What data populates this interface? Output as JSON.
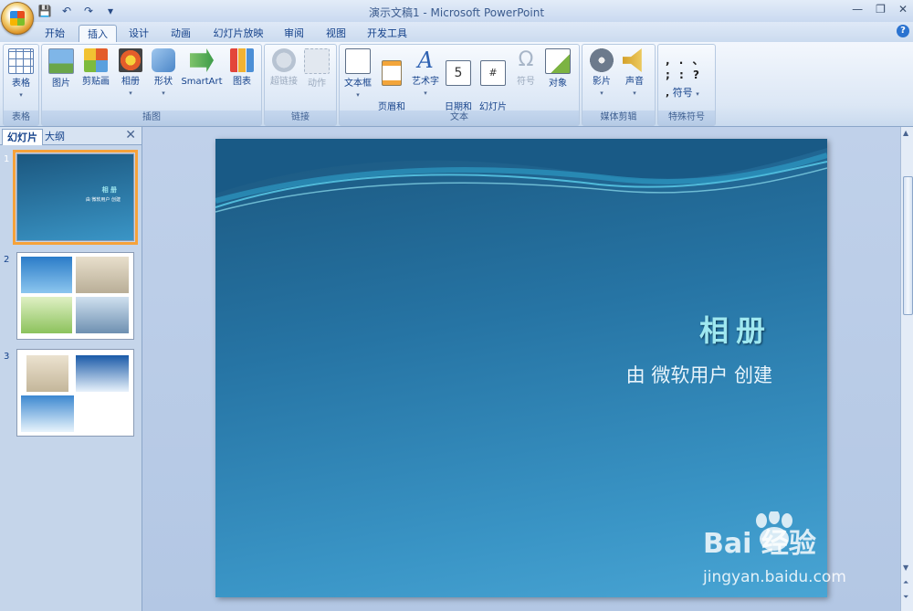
{
  "window": {
    "title": "演示文稿1 - Microsoft PowerPoint",
    "controls": [
      "minimize",
      "restore",
      "close"
    ]
  },
  "qat": {
    "icons": [
      "save-icon",
      "undo-icon",
      "redo-icon",
      "customize-icon"
    ]
  },
  "tabs": [
    {
      "label": "开始"
    },
    {
      "label": "插入"
    },
    {
      "label": "设计"
    },
    {
      "label": "动画"
    },
    {
      "label": "幻灯片放映"
    },
    {
      "label": "审阅"
    },
    {
      "label": "视图"
    },
    {
      "label": "开发工具"
    }
  ],
  "ribbon": {
    "groups": [
      {
        "label": "表格",
        "buttons": [
          {
            "label": "表格"
          }
        ]
      },
      {
        "label": "插图",
        "buttons": [
          {
            "label": "图片"
          },
          {
            "label": "剪贴画"
          },
          {
            "label": "相册"
          },
          {
            "label": "形状"
          },
          {
            "label": "SmartArt"
          },
          {
            "label": "图表"
          }
        ]
      },
      {
        "label": "链接",
        "buttons": [
          {
            "label": "超链接"
          },
          {
            "label": "动作"
          }
        ]
      },
      {
        "label": "文本",
        "buttons": [
          {
            "label": "文本框"
          },
          {
            "label": "页眉和\n页脚"
          },
          {
            "label": "艺术字"
          },
          {
            "label": "日期和\n时间"
          },
          {
            "label": "幻灯片\n编号"
          },
          {
            "label": "符号"
          },
          {
            "label": "对象"
          }
        ]
      },
      {
        "label": "媒体剪辑",
        "buttons": [
          {
            "label": "影片"
          },
          {
            "label": "声音"
          }
        ]
      },
      {
        "label": "特殊符号",
        "buttons": [
          {
            "label": "符号"
          }
        ],
        "symbols": [
          ", . 、",
          "; : ?",
          ","
        ]
      }
    ]
  },
  "slide_pane": {
    "tabs": [
      {
        "label": "幻灯片"
      },
      {
        "label": "大纲"
      }
    ],
    "thumbs": [
      {
        "num": "1",
        "title": "相 册",
        "sub": "由 微软用户 创建"
      },
      {
        "num": "2"
      },
      {
        "num": "3"
      }
    ]
  },
  "slide": {
    "title": "相册",
    "subtitle": "由 微软用户 创建"
  },
  "watermark": {
    "logo": "Bai  经验",
    "url": "jingyan.baidu.com"
  }
}
